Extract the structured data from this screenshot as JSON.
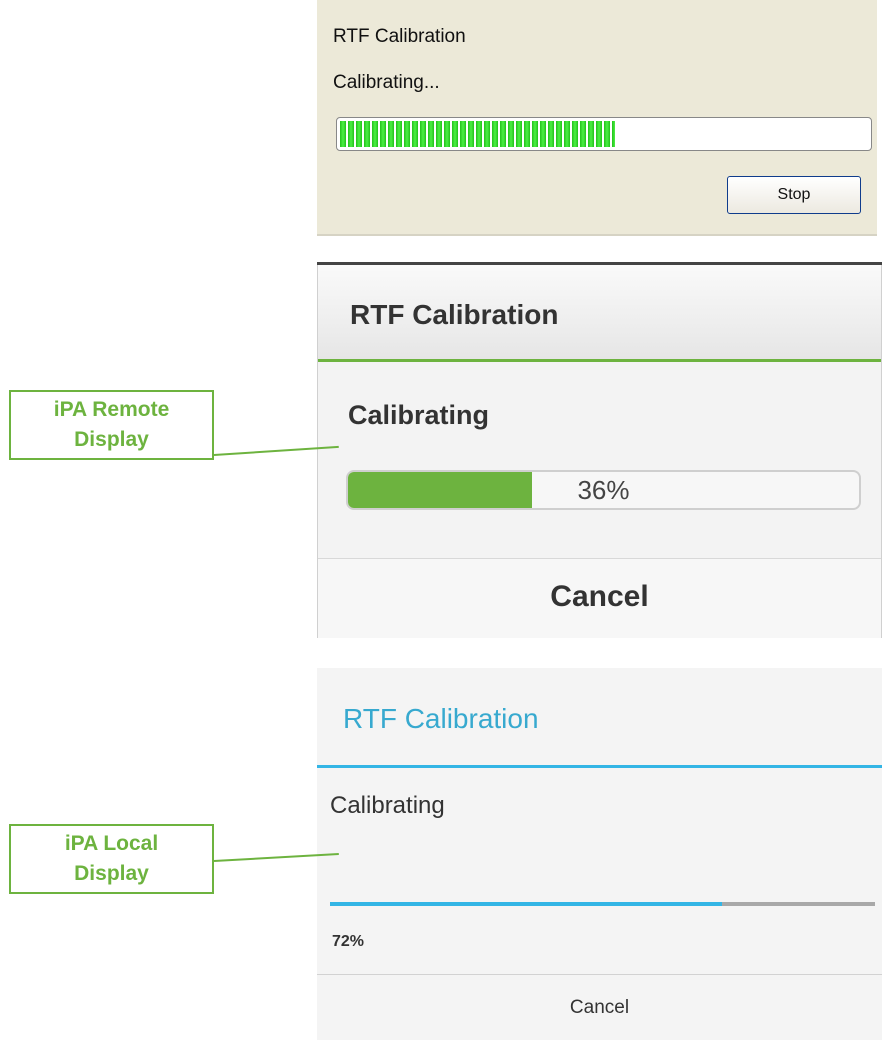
{
  "desktop_dialog": {
    "title": "RTF Calibration",
    "status": "Calibrating...",
    "progress": 0.52,
    "stop_label": "Stop",
    "accent_color": "#22c11a"
  },
  "remote_dialog": {
    "title": "RTF Calibration",
    "status": "Calibrating",
    "progress_text": "36%",
    "progress": 0.36,
    "cancel_label": "Cancel",
    "accent_color": "#6db33f"
  },
  "local_dialog": {
    "title": "RTF Calibration",
    "status": "Calibrating",
    "progress_text": "72%",
    "progress": 0.72,
    "cancel_label": "Cancel",
    "accent_color": "#33b5e5"
  },
  "callouts": {
    "remote": "iPA Remote\nDisplay",
    "local": "iPA Local\nDisplay",
    "color": "#6db33f"
  }
}
